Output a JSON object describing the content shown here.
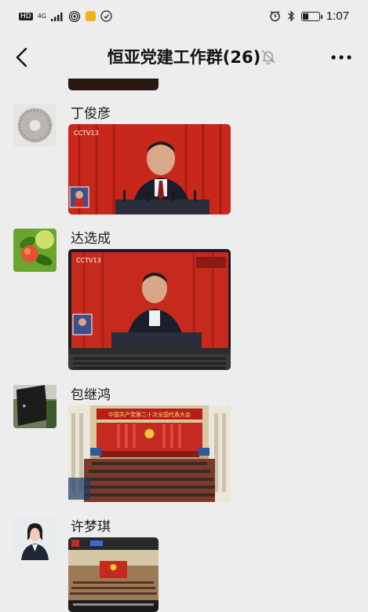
{
  "status_bar": {
    "network_label": "HD",
    "signal_label": "4G",
    "time": "1:07",
    "battery_level": 0.35
  },
  "nav": {
    "title": "恒亚党建工作群(26)",
    "icons": {
      "back": "back-arrow-icon",
      "mute": "muted-bell-icon",
      "more": "more-icon"
    }
  },
  "messages": [
    {
      "sender": "丁俊彦",
      "avatar": "stone-disc",
      "photo": "cctv-speech"
    },
    {
      "sender": "达选成",
      "avatar": "peach-fruit",
      "photo": "laptop-broadcast"
    },
    {
      "sender": "包继鸿",
      "avatar": "dark-sign",
      "photo": "congress-hall",
      "photo_banner": "中国共产党第二十次全国代表大会"
    },
    {
      "sender": "许梦琪",
      "avatar": "woman-portrait",
      "photo": "hall-video"
    }
  ],
  "colors": {
    "background": "#ededed",
    "stage_red": "#c8281c"
  }
}
